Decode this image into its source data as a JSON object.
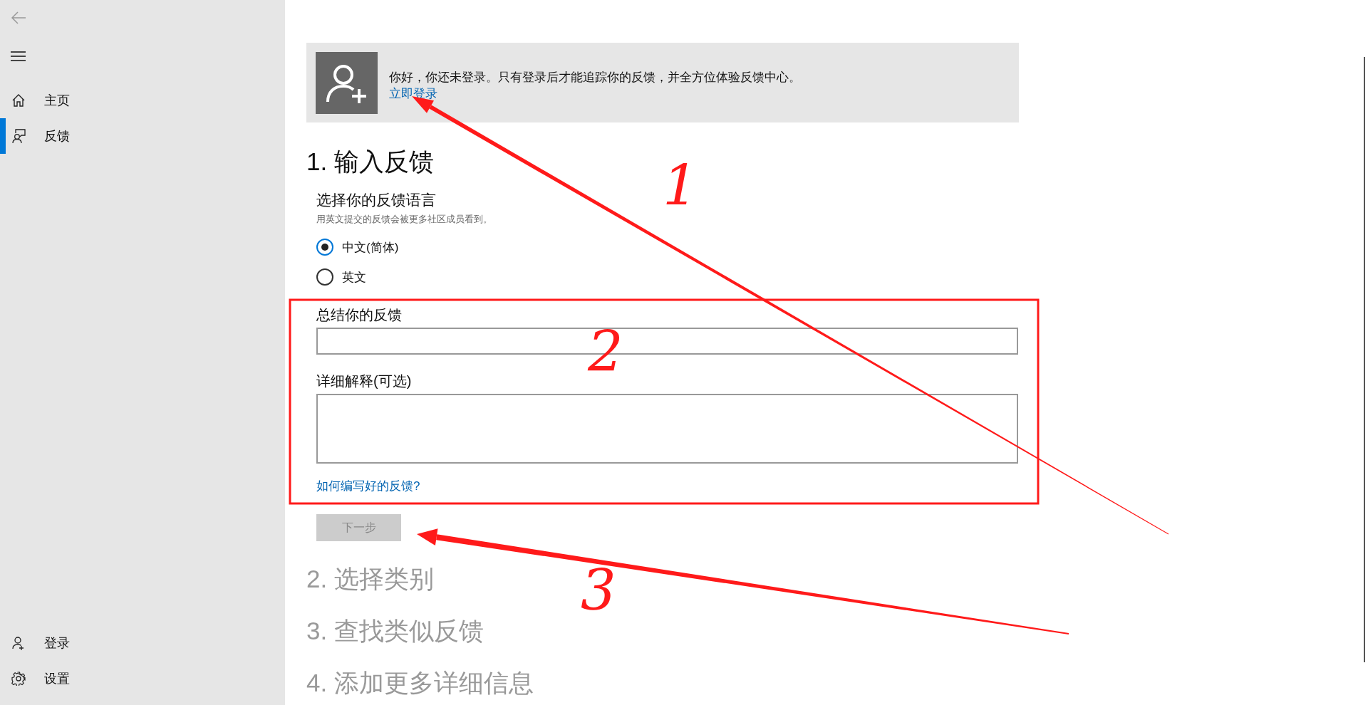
{
  "sidebar": {
    "top_items": [
      {
        "label": "主页",
        "selected": false
      },
      {
        "label": "反馈",
        "selected": true
      }
    ],
    "bottom_items": [
      {
        "label": "登录"
      },
      {
        "label": "设置"
      }
    ]
  },
  "banner": {
    "message": "你好，你还未登录。只有登录后才能追踪你的反馈，并全方位体验反馈中心。",
    "link": "立即登录"
  },
  "steps": [
    {
      "title": "1. 输入反馈",
      "active": true
    },
    {
      "title": "2. 选择类别",
      "active": false
    },
    {
      "title": "3. 查找类似反馈",
      "active": false
    },
    {
      "title": "4. 添加更多详细信息",
      "active": false
    }
  ],
  "language": {
    "title": "选择你的反馈语言",
    "hint": "用英文提交的反馈会被更多社区成员看到。",
    "options": [
      {
        "label": "中文(简体)",
        "selected": true
      },
      {
        "label": "英文",
        "selected": false
      }
    ]
  },
  "summary": {
    "label": "总结你的反馈"
  },
  "details": {
    "label": "详细解释(可选)"
  },
  "help_link": "如何编写好的反馈?",
  "next_button": {
    "label": "下一步",
    "disabled": true
  },
  "annotations": {
    "labels": [
      "1",
      "2",
      "3"
    ]
  }
}
